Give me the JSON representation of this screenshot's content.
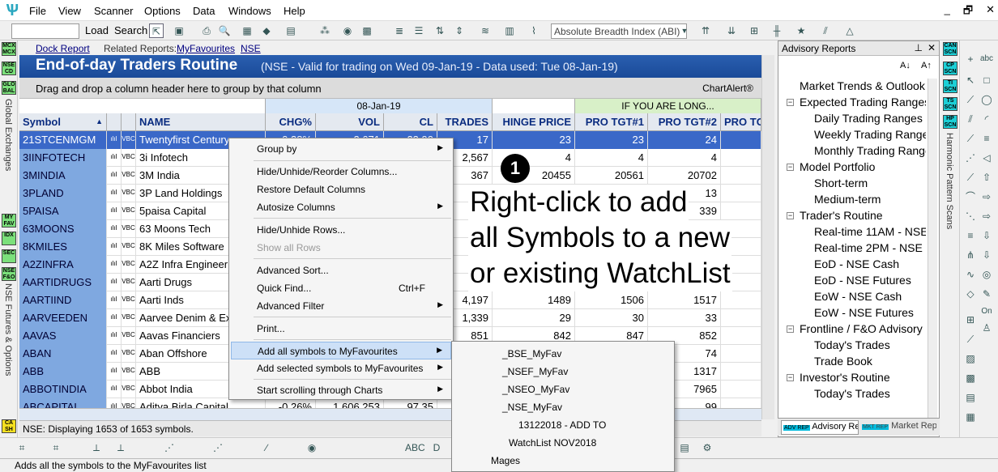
{
  "menu": [
    "File",
    "View",
    "Scanner",
    "Options",
    "Data",
    "Windows",
    "Help"
  ],
  "window_controls": [
    "_",
    "🗗",
    "✕"
  ],
  "toolbar": {
    "load": "Load",
    "search": "Search",
    "indicator": "Absolute Breadth Index (ABI)",
    "chevron": "▼"
  },
  "reportbar": {
    "dock": "Dock Report",
    "related_label": "Related Reports:",
    "fav": "MyFavourites",
    "nse": "NSE"
  },
  "title": {
    "main": "End-of-day Traders Routine",
    "sub": "(NSE - Valid for trading on Wed 09-Jan-19 - Data used: Tue 08-Jan-19)"
  },
  "groupbar": {
    "text": "Drag and drop a column header here to group by that column",
    "chartalert": "ChartAlert®"
  },
  "grid": {
    "band_date": "08-Jan-19",
    "band_long": "IF YOU ARE LONG...",
    "headers": [
      "Symbol",
      "NAME",
      "CHG%",
      "VOL",
      "CL",
      "TRADES",
      "HINGE PRICE",
      "PRO TGT#1",
      "PRO TGT#2",
      "PRO TG"
    ],
    "sort_icon": "▲",
    "mini1": "ılıl",
    "mini2": "VBC",
    "rows": [
      {
        "sym": "21STCENMGM",
        "name": "Twentyfirst Century",
        "chg": "-0.38%",
        "vol": "2,671",
        "cl": "23.90",
        "trades": "17",
        "hinge": "23",
        "t1": "23",
        "t2": "24"
      },
      {
        "sym": "3IINFOTECH",
        "name": "3i Infotech",
        "chg": "",
        "vol": "",
        "cl": "",
        "trades": "2,567",
        "hinge": "4",
        "t1": "4",
        "t2": "4"
      },
      {
        "sym": "3MINDIA",
        "name": "3M India",
        "chg": "",
        "vol": "",
        "cl": "",
        "trades": "367",
        "hinge": "20455",
        "t1": "20561",
        "t2": "20702"
      },
      {
        "sym": "3PLAND",
        "name": "3P Land Holdings",
        "chg": "",
        "vol": "",
        "cl": "",
        "trades": "",
        "hinge": "",
        "t1": "",
        "t2": "13"
      },
      {
        "sym": "5PAISA",
        "name": "5paisa Capital",
        "chg": "",
        "vol": "",
        "cl": "",
        "trades": "",
        "hinge": "",
        "t1": "",
        "t2": "339"
      },
      {
        "sym": "63MOONS",
        "name": "63 Moons Tech",
        "chg": "",
        "vol": "",
        "cl": "",
        "trades": "1",
        "hinge": "",
        "t1": "",
        "t2": ""
      },
      {
        "sym": "8KMILES",
        "name": "8K Miles Software",
        "chg": "",
        "vol": "",
        "cl": "",
        "trades": "",
        "hinge": "",
        "t1": "",
        "t2": ""
      },
      {
        "sym": "A2ZINFRA",
        "name": "A2Z Infra Engineering",
        "chg": "",
        "vol": "",
        "cl": "",
        "trades": "",
        "hinge": "",
        "t1": "",
        "t2": ""
      },
      {
        "sym": "AARTIDRUGS",
        "name": "Aarti Drugs",
        "chg": "",
        "vol": "",
        "cl": "",
        "trades": "",
        "hinge": "",
        "t1": "",
        "t2": ""
      },
      {
        "sym": "AARTIIND",
        "name": "Aarti Inds",
        "chg": "",
        "vol": "",
        "cl": "",
        "trades": "4,197",
        "hinge": "1489",
        "t1": "1506",
        "t2": "1517"
      },
      {
        "sym": "AARVEEDEN",
        "name": "Aarvee Denim & Exports",
        "chg": "",
        "vol": "",
        "cl": "",
        "trades": "1,339",
        "hinge": "29",
        "t1": "30",
        "t2": "33"
      },
      {
        "sym": "AAVAS",
        "name": "Aavas Financiers",
        "chg": "",
        "vol": "",
        "cl": "",
        "trades": "851",
        "hinge": "842",
        "t1": "847",
        "t2": "852"
      },
      {
        "sym": "ABAN",
        "name": "Aban Offshore",
        "chg": "",
        "vol": "",
        "cl": "",
        "trades": "",
        "hinge": "",
        "t1": "",
        "t2": "74"
      },
      {
        "sym": "ABB",
        "name": "ABB",
        "chg": "",
        "vol": "",
        "cl": "",
        "trades": "",
        "hinge": "",
        "t1": "",
        "t2": "1317"
      },
      {
        "sym": "ABBOTINDIA",
        "name": "Abbot India",
        "chg": "",
        "vol": "",
        "cl": "",
        "trades": "",
        "hinge": "",
        "t1": "",
        "t2": "7965"
      },
      {
        "sym": "ABCAPITAL",
        "name": "Aditya Birla Capital",
        "chg": "-0.26%",
        "vol": "1,606,253",
        "cl": "97.35",
        "trades": "",
        "hinge": "",
        "t1": "",
        "t2": "99"
      }
    ]
  },
  "status": "NSE: Displaying 1653 of 1653 symbols.",
  "statusbar": "Adds all the symbols to the MyFavourites list",
  "context_menu": {
    "group_by": "Group by",
    "hide_cols": "Hide/Unhide/Reorder Columns...",
    "restore": "Restore Default Columns",
    "autosize": "Autosize Columns",
    "hide_rows": "Hide/Unhide Rows...",
    "show_rows": "Show all Rows",
    "adv_sort": "Advanced Sort...",
    "quick_find": "Quick Find...",
    "quick_find_sc": "Ctrl+F",
    "adv_filter": "Advanced Filter",
    "print": "Print...",
    "add_all": "Add all symbols to MyFavourites",
    "add_sel": "Add selected symbols to MyFavourites",
    "start_scroll": "Start scrolling through Charts",
    "arrow": "▶"
  },
  "submenu": [
    "_BSE_MyFav",
    "_NSEF_MyFav",
    "_NSEO_MyFav",
    "_NSE_MyFav",
    "13122018 - ADD TO",
    "WatchList NOV2018",
    "Mages"
  ],
  "annotation": {
    "number": "1",
    "line1": "Right-click to add",
    "line2": "all Symbols to a new",
    "line3": "or existing WatchList"
  },
  "advisory": {
    "title": "Advisory Reports",
    "tree": [
      {
        "label": "Market Trends & Outlook",
        "level": 0,
        "box": ""
      },
      {
        "label": "Expected Trading Ranges",
        "level": 0,
        "box": "−"
      },
      {
        "label": "Daily Trading Ranges",
        "level": 1,
        "box": ""
      },
      {
        "label": "Weekly Trading Ranges",
        "level": 1,
        "box": ""
      },
      {
        "label": "Monthly Trading Ranges",
        "level": 1,
        "box": ""
      },
      {
        "label": "Model Portfolio",
        "level": 0,
        "box": "−"
      },
      {
        "label": "Short-term",
        "level": 1,
        "box": ""
      },
      {
        "label": "Medium-term",
        "level": 1,
        "box": ""
      },
      {
        "label": "Trader's Routine",
        "level": 0,
        "box": "−"
      },
      {
        "label": "Real-time 11AM - NSE",
        "level": 1,
        "box": ""
      },
      {
        "label": "Real-time 2PM - NSE",
        "level": 1,
        "box": ""
      },
      {
        "label": "EoD - NSE Cash",
        "level": 1,
        "box": ""
      },
      {
        "label": "EoD - NSE Futures",
        "level": 1,
        "box": ""
      },
      {
        "label": "EoW - NSE Cash",
        "level": 1,
        "box": ""
      },
      {
        "label": "EoW - NSE Futures",
        "level": 1,
        "box": ""
      },
      {
        "label": "Frontline / F&O Advisory",
        "level": 0,
        "box": "−"
      },
      {
        "label": "Today's Trades",
        "level": 1,
        "box": ""
      },
      {
        "label": "Trade Book",
        "level": 1,
        "box": ""
      },
      {
        "label": "Investor's Routine",
        "level": 0,
        "box": "−"
      },
      {
        "label": "Today's Trades",
        "level": 1,
        "box": ""
      }
    ],
    "tab1": "Advisory Re...",
    "tab2": "Market Rep...",
    "badge1": "ADV REP",
    "badge2": "MKT REP"
  },
  "left_badges": [
    "MCX MCX",
    "NSE CD",
    "GLO BAL",
    "MY FAV",
    "IDX",
    "SEC",
    "NSE F&O",
    "CA SH"
  ],
  "left_labels": [
    "Global Exchanges",
    "NSE Futures & Options"
  ],
  "right_badges": [
    "CAN SCN",
    "CP SCN",
    "TI SCN",
    "TS SCN",
    "HP SCN"
  ],
  "right_label": "Harmonic Pattern Scans",
  "right_draw_labels": [
    "abc",
    "On"
  ],
  "colors": {
    "title_bg": "#1a4a98",
    "symbol_col": "#7fa8e0",
    "selected_row": "#3a68c8",
    "long_band": "#d8f0c8"
  }
}
